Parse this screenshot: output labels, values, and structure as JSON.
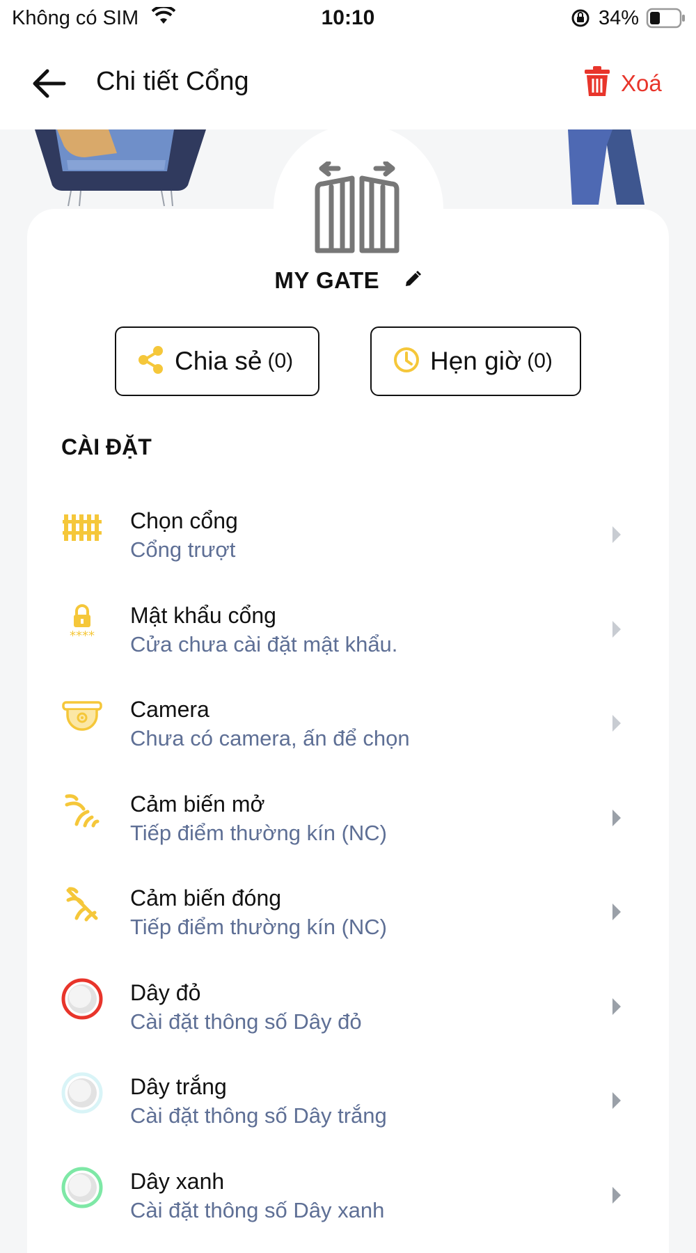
{
  "status_bar": {
    "carrier": "Không có SIM",
    "time": "10:10",
    "battery": "34%"
  },
  "header": {
    "title": "Chi tiết Cổng",
    "delete_label": "Xoá"
  },
  "gate": {
    "name": "MY GATE"
  },
  "actions": {
    "share_label": "Chia sẻ",
    "share_count": "(0)",
    "timer_label": "Hẹn giờ",
    "timer_count": "(0)"
  },
  "settings": {
    "section_title": "CÀI ĐẶT",
    "items": [
      {
        "title": "Chọn cổng",
        "subtitle": "Cổng trượt",
        "icon": "fence-icon"
      },
      {
        "title": "Mật khẩu cổng",
        "subtitle": "Cửa chưa cài đặt mật khẩu.",
        "icon": "password-lock-icon"
      },
      {
        "title": "Camera",
        "subtitle": "Chưa có camera, ấn để chọn",
        "icon": "camera-icon"
      },
      {
        "title": "Cảm biến mở",
        "subtitle": "Tiếp điểm thường kín (NC)",
        "icon": "sensor-open-icon"
      },
      {
        "title": "Cảm biến đóng",
        "subtitle": "Tiếp điểm thường kín (NC)",
        "icon": "sensor-close-icon"
      },
      {
        "title": "Dây đỏ",
        "subtitle": "Cài đặt thông số Dây đỏ",
        "icon": "red-wire-icon"
      },
      {
        "title": "Dây trắng",
        "subtitle": "Cài đặt thông số Dây trắng",
        "icon": "white-wire-icon"
      },
      {
        "title": "Dây xanh",
        "subtitle": "Cài đặt thông số Dây xanh",
        "icon": "green-wire-icon"
      }
    ]
  },
  "colors": {
    "accent_yellow": "#f5c73a",
    "delete_red": "#e8352b",
    "subtitle_blue": "#5e6f95",
    "wire_red": "#e8352b",
    "wire_white": "#d9f4f7",
    "wire_green": "#7ee8a6"
  }
}
